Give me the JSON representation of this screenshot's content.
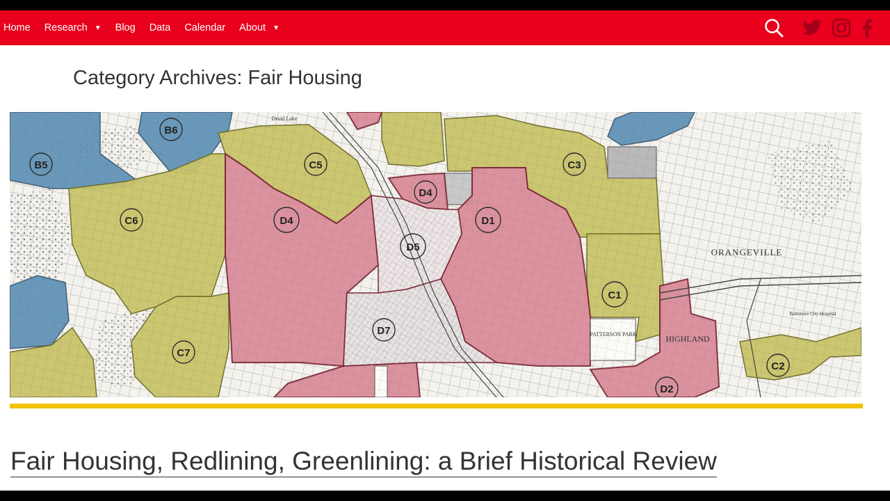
{
  "nav": {
    "items": [
      {
        "label": "Home"
      },
      {
        "label": "Research",
        "has_dropdown": true
      },
      {
        "label": "Blog"
      },
      {
        "label": "Data"
      },
      {
        "label": "Calendar"
      },
      {
        "label": "About",
        "has_dropdown": true
      }
    ],
    "icons": [
      "search-icon",
      "twitter-icon",
      "instagram-icon",
      "facebook-icon"
    ],
    "background_color": "#e8001c"
  },
  "page": {
    "title": "Category Archives: Fair Housing"
  },
  "hero_map": {
    "zone_labels": [
      "B5",
      "B6",
      "C5",
      "C6",
      "C7",
      "D4",
      "D4",
      "D5",
      "D1",
      "D7",
      "C3",
      "C1",
      "C2",
      "D2"
    ],
    "place_labels": [
      "ORANGEVILLE",
      "PATTERSON PARK",
      "HIGHLAND",
      "Baltimore City Hospital",
      "Druid Lake"
    ],
    "colors": {
      "blue": "#5b8fb5",
      "yellow": "#c9c46a",
      "red": "#d98a98",
      "hatch": "#e9e4e4"
    }
  },
  "post": {
    "title": "Fair Housing, Redlining, Greenlining: a Brief Historical Review"
  },
  "accent_color": "#f2c200"
}
